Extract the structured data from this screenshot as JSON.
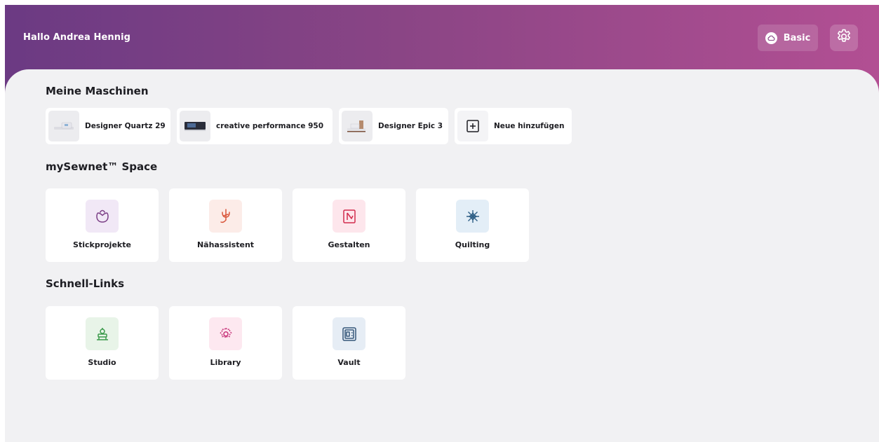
{
  "header": {
    "greeting": "Hallo Andrea Hennig",
    "plan_label": "Basic",
    "plan_icon": "cloud-icon",
    "settings_icon": "gear-icon"
  },
  "sections": {
    "machines_title": "Meine Maschinen",
    "space_title": "mySewnet™ Space",
    "links_title": "Schnell-Links"
  },
  "machines": [
    {
      "label": "Designer Quartz 29"
    },
    {
      "label": "creative performance 950"
    },
    {
      "label": "Designer Epic 3"
    }
  ],
  "add_machine_label": "Neue hinzufügen",
  "space_tiles": [
    {
      "label": "Stickprojekte",
      "icon": "flower-icon",
      "color": "#7b3f86"
    },
    {
      "label": "Nähassistent",
      "icon": "thread-icon",
      "color": "#d9553a"
    },
    {
      "label": "Gestalten",
      "icon": "design-icon",
      "color": "#d22b4c"
    },
    {
      "label": "Quilting",
      "icon": "quilt-star-icon",
      "color": "#2e5f86"
    }
  ],
  "link_tiles": [
    {
      "label": "Studio",
      "icon": "studio-icon",
      "color": "#3b9a4a"
    },
    {
      "label": "Library",
      "icon": "library-icon",
      "color": "#c8357a"
    },
    {
      "label": "Vault",
      "icon": "vault-icon",
      "color": "#35577a"
    }
  ],
  "colors": {
    "header_start": "#6b3a83",
    "header_end": "#b24f93",
    "background": "#f1f1f3"
  }
}
